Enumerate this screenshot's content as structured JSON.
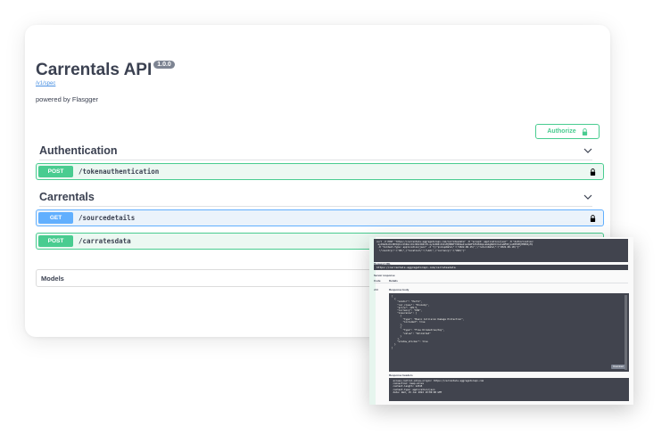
{
  "app": {
    "title": "Carrentals API",
    "version": "1.0.0",
    "spec_link": "/v1/spec",
    "powered_by": "powered by Flasgger"
  },
  "authorize": {
    "label": "Authorize"
  },
  "sections": [
    {
      "name": "Authentication",
      "operations": [
        {
          "method": "POST",
          "path": "/tokenauthentication"
        }
      ]
    },
    {
      "name": "Carrentals",
      "operations": [
        {
          "method": "GET",
          "path": "/sourcedetails"
        },
        {
          "method": "POST",
          "path": "/carratesdata"
        }
      ]
    }
  ],
  "models": {
    "label": "Models"
  },
  "response_panel": {
    "curl_text": "curl -X POST \"https://carrentals.aggregatorapi.com/carratesdata\" -H \"accept: application/json\" -H \"Authorization:\n eyJ0eXAiOiJKV1QiLCJhbGciOiJIUzI1NiJ9.eyJzdWIiOiIxMjM0NTY3ODkwIiwibmFtZSI6IkpvaG4gRG9lIiwiaWF0IjoxNTE2MjM5MDIyfQ\n -H \"Content-Type: application/json\" -d \"{\\\"pickupDate\\\":\\\"2022-06-15\\\",\\\"returnDate\\\":\\\"2022-06-18\\\"}\"\n  \\\"country\\\":\\\"US\\\",\\\"location\\\":\\\"LAX\\\",\\\"currency\\\":\\\"USD\\\"}\"",
    "request_url_label": "Request URL",
    "request_url": "https://carrentals.aggregatorapi.com/carratesdata",
    "server_response_label": "Server response",
    "code_label": "Code",
    "details_label": "Details",
    "status_code": "200",
    "response_body_label": "Response body",
    "response_body": "[\n  {\n    \"vendor\": \"Hertz\",\n    \"car_class\": \"Economy\",\n    \"price\": 129.5,\n    \"currency\": \"USD\",\n    \"insurance\": [\n      {\n        \"type\": \"Basic Collision Damage Protection\",\n        \"included\": true\n      },\n      {\n        \"type\": \"Free Kilometres/day\",\n        \"value\": \"Unlimited\"\n      }\n    ],\n    \"window_sticker\": true\n  }\n]",
    "download_label": "Download",
    "response_headers_label": "Response headers",
    "response_headers": " access-control-allow-origin: https://carrentals.aggregatorapi.com\n connection: keep-alive\n content-length: 12345\n content-type: application/json\n date: Wed, 15 Jun 2022 10:00:00 GMT"
  }
}
